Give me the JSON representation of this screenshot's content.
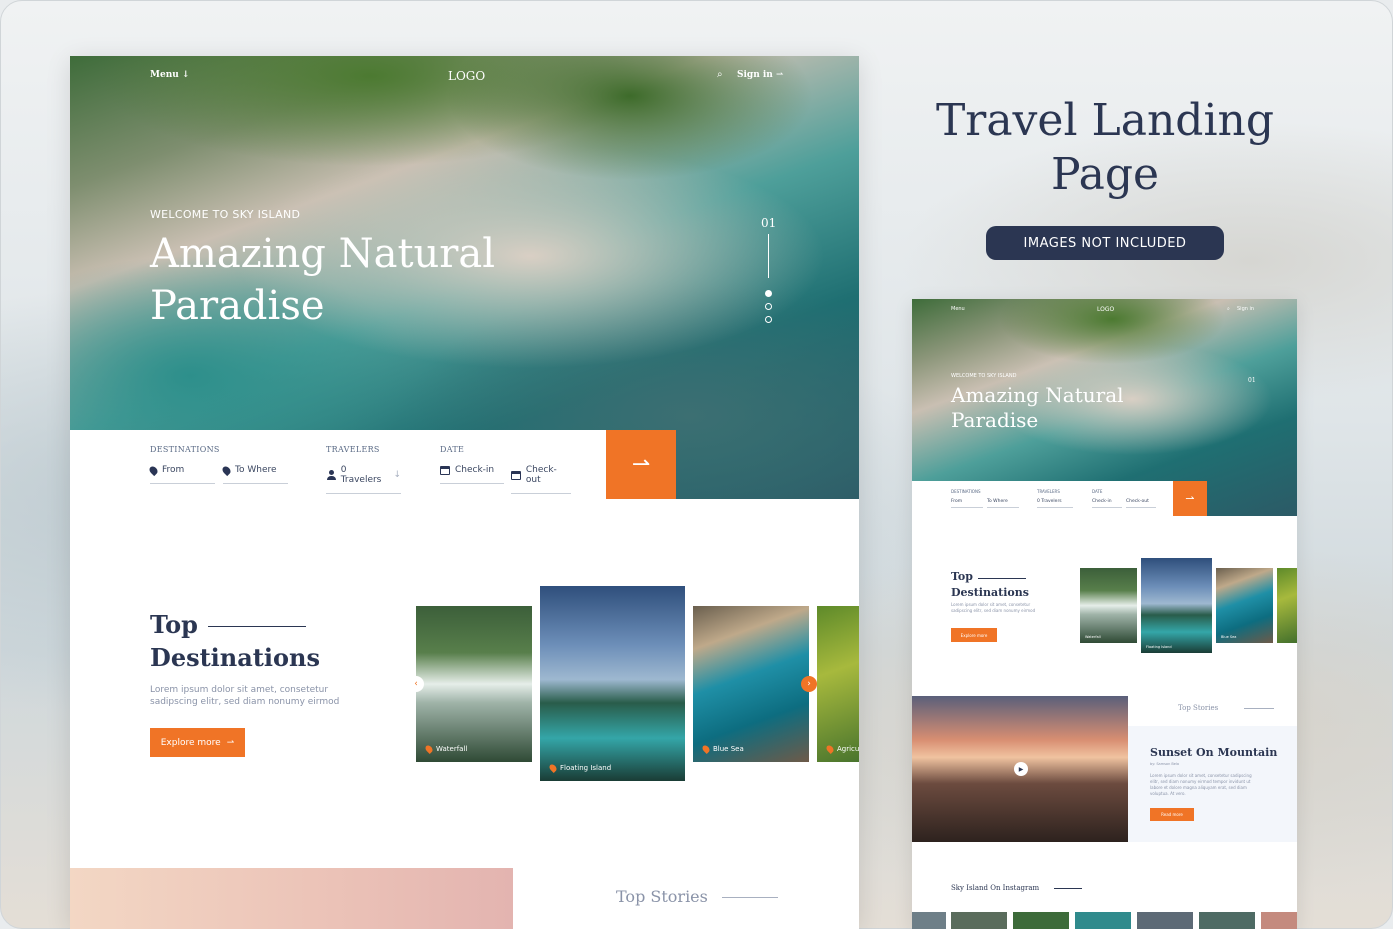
{
  "colors": {
    "accent": "#f07426",
    "navy": "#2b3652",
    "muted": "#8a93a8"
  },
  "main": {
    "nav": {
      "menu": "Menu",
      "logo": "LOGO",
      "sign_in": "Sign in"
    },
    "hero": {
      "eyebrow": "WELCOME TO SKY ISLAND",
      "headline": "Amazing Natural Paradise",
      "slide_number": "01"
    },
    "search": {
      "destinations_label": "DESTINATIONS",
      "from": "From",
      "to_where": "To Where",
      "travelers_label": "TRAVELERS",
      "travelers": "0 Travelers",
      "date_label": "DATE",
      "check_in": "Check-in",
      "check_out": "Check-out"
    },
    "top_destinations": {
      "title": "Top Destinations",
      "description": "Lorem ipsum dolor sit amet, consetetur sadipscing elitr, sed diam nonumy eirmod",
      "explore": "Explore more",
      "cards": [
        {
          "label": "Waterfall"
        },
        {
          "label": "Floating Island"
        },
        {
          "label": "Blue Sea"
        },
        {
          "label": "Agricultur"
        }
      ]
    },
    "stories": {
      "title": "Top Stories"
    }
  },
  "side": {
    "title": "Travel Landing Page",
    "badge": "IMAGES NOT INCLUDED"
  },
  "small": {
    "nav": {
      "menu": "Menu",
      "logo": "LOGO",
      "sign_in": "Sign in"
    },
    "hero": {
      "eyebrow": "WELCOME TO SKY ISLAND",
      "headline": "Amazing Natural Paradise",
      "slide_number": "01"
    },
    "search": {
      "destinations_label": "DESTINATIONS",
      "from": "From",
      "to_where": "To Where",
      "travelers_label": "TRAVELERS",
      "travelers": "0 Travelers",
      "date_label": "DATE",
      "check_in": "Check-in",
      "check_out": "Check-out"
    },
    "top_destinations": {
      "title": "Top Destinations",
      "description": "Lorem ipsum dolor sit amet, consetetur sadipscing elitr, sed diam nonumy eirmod",
      "explore": "Explore more",
      "cards": [
        {
          "label": "Waterfall"
        },
        {
          "label": "Floating Island"
        },
        {
          "label": "Blue Sea"
        }
      ]
    },
    "stories": {
      "label": "Top Stories",
      "title": "Sunset On Mountain",
      "byline": "by: Samson Bela",
      "description": "Lorem ipsum dolor sit amet, consetetur sadipscing elitr, sed diam nonumy eirmod tempor invidunt ut labore et dolore magna aliquyam erat, sed diam voluptua. At vero.",
      "read_more": "Read more"
    },
    "instagram": {
      "title": "Sky Island On Instagram"
    }
  }
}
